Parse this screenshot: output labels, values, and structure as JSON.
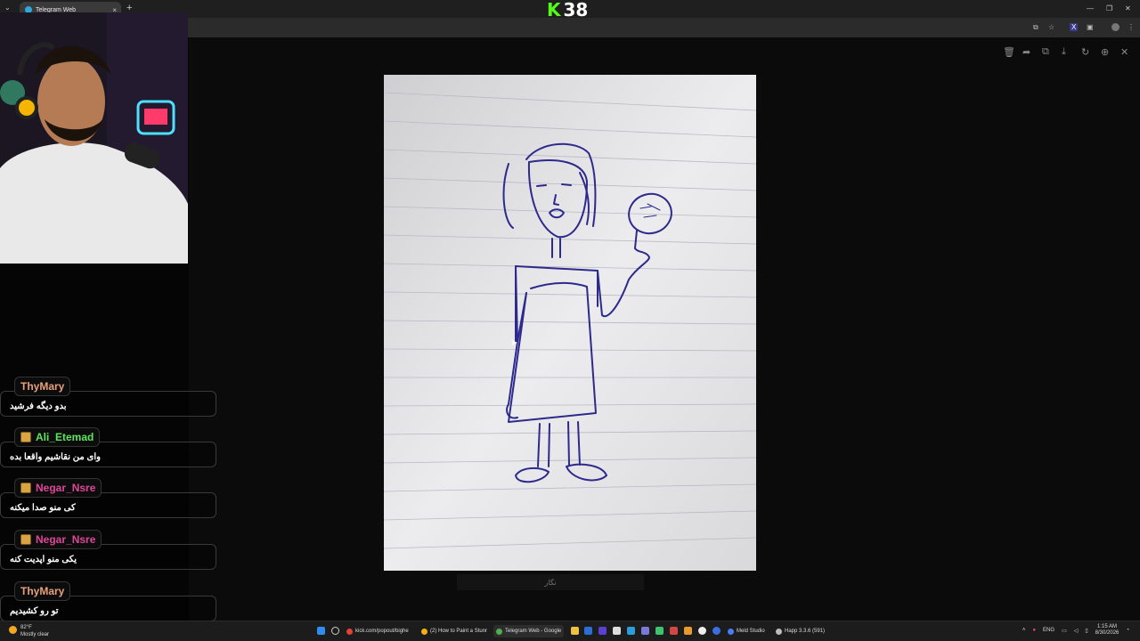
{
  "browser": {
    "tab_title": "Telegram Web",
    "new_tab_symbol": "+",
    "close_symbol": "×",
    "menu_symbol": "⌄"
  },
  "overlay": {
    "kick_letter": "K",
    "kick_number": "38",
    "kick_color": "#53fc18"
  },
  "viewer": {
    "caption": "نگار",
    "tools": [
      "trash-icon",
      "forward-icon",
      "copy-icon",
      "download-icon",
      "rotate-icon",
      "zoom-icon",
      "close-icon"
    ]
  },
  "chat": {
    "messages": [
      {
        "user": "ThyMary",
        "color": "#e8a07a",
        "text": "بدو دیگه فرشید",
        "badge": false
      },
      {
        "user": "Ali_Etemad",
        "color": "#5ce65c",
        "text": "وای من نقاشیم واقعا بده",
        "badge": true
      },
      {
        "user": "Negar_Nsre",
        "color": "#e0459a",
        "text": "کی منو صدا میکنه",
        "badge": true
      },
      {
        "user": "Negar_Nsre",
        "color": "#e0459a",
        "text": "یکی منو اپدیت کنه",
        "badge": true
      },
      {
        "user": "ThyMary",
        "color": "#e8a07a",
        "text": "تو رو کشیدیم",
        "badge": false
      }
    ]
  },
  "taskbar": {
    "weather_temp": "82°F",
    "weather_desc": "Mostly clear",
    "apps": [
      {
        "label": "kick.com/popout/bighe",
        "color": "#e34133",
        "active": false
      },
      {
        "label": "(2) How to Paint a Stunr",
        "color": "#f2b10f",
        "active": false
      },
      {
        "label": "Telegram Web - Google",
        "color": "#4caf50",
        "active": true
      },
      {
        "label": "Meld Studio",
        "color": "#4c7bf3",
        "active": false
      },
      {
        "label": "Happ 3.3.6 (591)",
        "color": "#bbbbbb",
        "active": false
      }
    ],
    "lang": "ENG",
    "time": "1:15 AM",
    "date": "8/30/2026"
  }
}
